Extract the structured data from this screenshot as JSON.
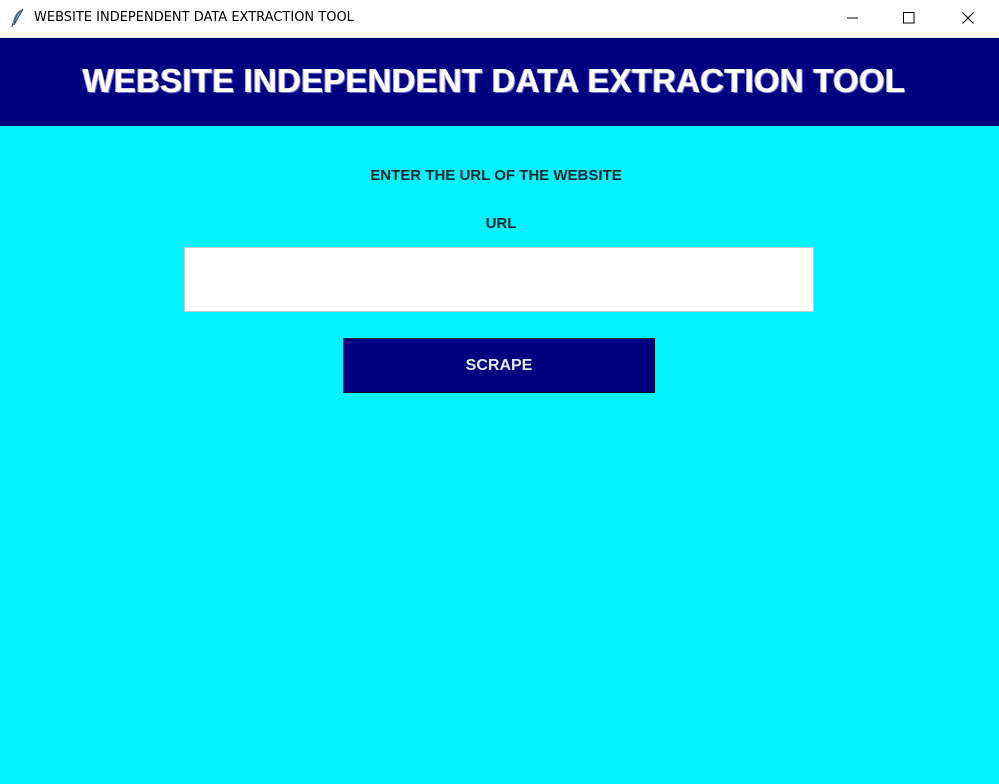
{
  "window": {
    "title": "WEBSITE INDEPENDENT DATA EXTRACTION TOOL",
    "app_icon": "feather-icon",
    "controls": {
      "minimize_icon": "minimize-icon",
      "maximize_icon": "maximize-icon",
      "close_icon": "close-icon"
    }
  },
  "banner": {
    "title": "WEBSITE INDEPENDENT DATA EXTRACTION TOOL"
  },
  "form": {
    "prompt": "ENTER THE URL OF THE WEBSITE",
    "url_label": "URL",
    "url_value": "",
    "scrape_label": "SCRAPE"
  },
  "colors": {
    "background": "#00F3FF",
    "banner": "#000080",
    "button": "#000080",
    "input": "#FFFFFF"
  }
}
